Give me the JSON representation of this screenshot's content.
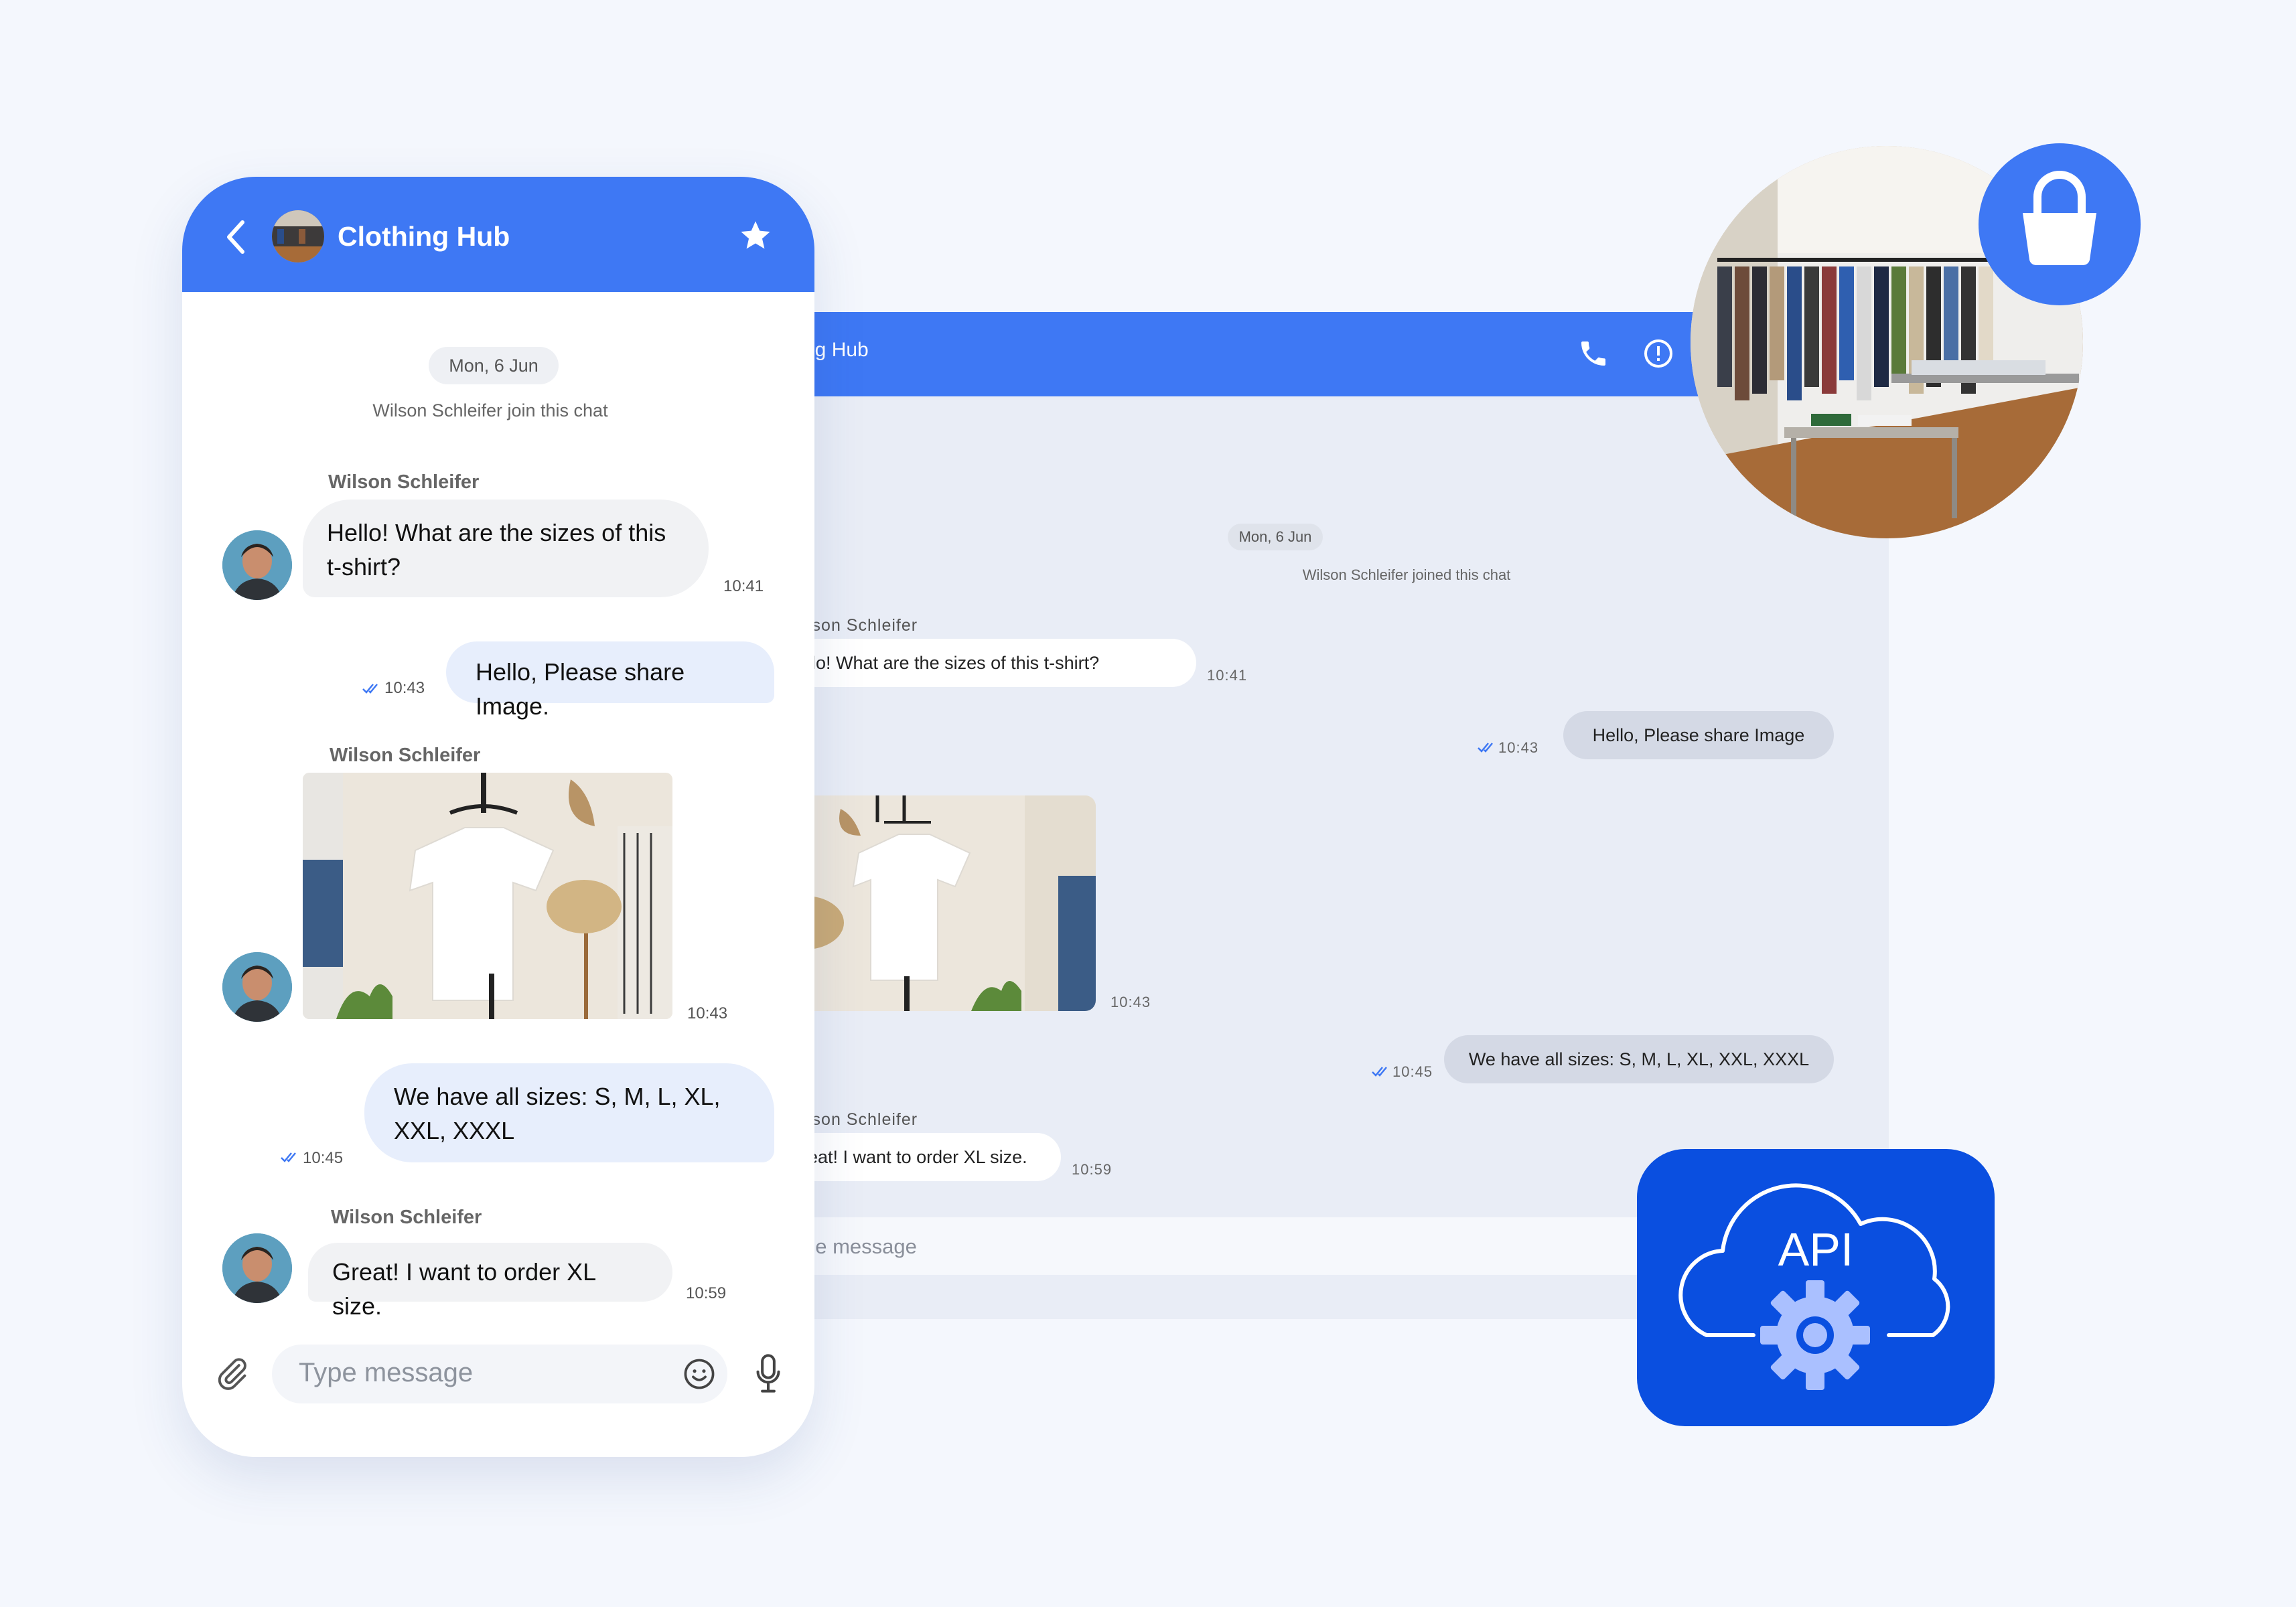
{
  "desktop": {
    "header_title": "ng Hub",
    "date_chip": "Mon, 6 Jun",
    "join_text": "Wilson Schleifer joined this chat",
    "messages": [
      {
        "sender": "lson Schleifer",
        "text": "llo! What are the sizes of this t-shirt?",
        "time": "10:41"
      },
      {
        "text": "Hello, Please share Image",
        "time": "10:43"
      },
      {
        "time": "10:43"
      },
      {
        "text": "We have all sizes: S, M, L, XL, XXL, XXXL",
        "time": "10:45"
      },
      {
        "sender": "lson Schleifer",
        "text": "eat! I want to order XL size.",
        "time": "10:59"
      }
    ],
    "input_placeholder": "pe message"
  },
  "phone": {
    "header_title": "Clothing Hub",
    "date_chip": "Mon, 6 Jun",
    "join_text": "Wilson Schleifer join this chat",
    "messages": [
      {
        "sender": "Wilson Schleifer",
        "text_line1": "Hello! What are the sizes of this",
        "text_line2": "t-shirt?",
        "time": "10:41"
      },
      {
        "text": "Hello, Please share Image.",
        "time": "10:43"
      },
      {
        "sender": "Wilson Schleifer",
        "time": "10:43"
      },
      {
        "text_line1": "We have all sizes: S, M, L, XL,",
        "text_line2": "XXL, XXXL",
        "time": "10:45"
      },
      {
        "sender": "Wilson Schleifer",
        "text": "Great! I want to order XL size.",
        "time": "10:59"
      }
    ],
    "input_placeholder": "Type message"
  },
  "api_tile": {
    "label": "API"
  },
  "colors": {
    "brand_blue": "#3e78f4",
    "api_blue": "#0a4fe0",
    "outgoing_bubble": "#e7eefc",
    "check_blue": "#3e78f4"
  },
  "icons": [
    "back-arrow-icon",
    "star-icon",
    "phone-call-icon",
    "info-icon",
    "paperclip-icon",
    "emoji-icon",
    "microphone-icon",
    "shopping-bag-icon",
    "cloud-gear-icon",
    "double-check-icon"
  ]
}
